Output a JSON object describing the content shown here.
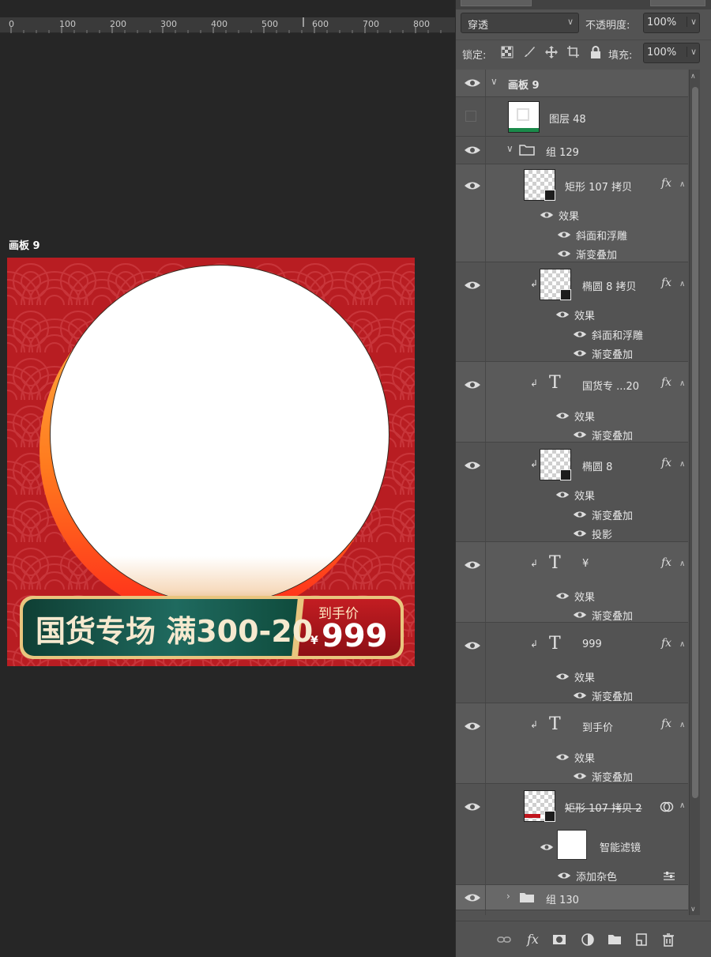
{
  "ruler": {
    "ticks": [
      "0",
      "100",
      "200",
      "300",
      "400",
      "500",
      "600",
      "700",
      "800"
    ]
  },
  "artboard": {
    "label": "画板 9",
    "promo_text": "国货专场 满300-20",
    "price_label": "到手价",
    "price_currency": "¥",
    "price_value": "999"
  },
  "panel": {
    "blend_mode": "穿透",
    "opacity_label": "不透明度:",
    "opacity_value": "100%",
    "lock_label": "锁定:",
    "fill_label": "填充:",
    "fill_value": "100%"
  },
  "layers": {
    "artboard_group": "画板 9",
    "layer48": "图层 48",
    "group129": "组 129",
    "rect107": {
      "name": "矩形 107 拷贝",
      "effects": "效果",
      "fx1": "斜面和浮雕",
      "fx2": "渐变叠加"
    },
    "ellipse8copy": {
      "name": "椭圆 8 拷贝",
      "effects": "效果",
      "fx1": "斜面和浮雕",
      "fx2": "渐变叠加"
    },
    "text_promo": {
      "name": "国货专 ...20",
      "effects": "效果",
      "fx1": "渐变叠加"
    },
    "ellipse8": {
      "name": "椭圆 8",
      "effects": "效果",
      "fx1": "渐变叠加",
      "fx2": "投影"
    },
    "text_yen": {
      "name": "¥",
      "effects": "效果",
      "fx1": "渐变叠加"
    },
    "text_999": {
      "name": "999",
      "effects": "效果",
      "fx1": "渐变叠加"
    },
    "text_price": {
      "name": "到手价",
      "effects": "效果",
      "fx1": "渐变叠加"
    },
    "rect107copy2": {
      "name": "矩形 107 拷贝 2",
      "smart_filter": "智能滤镜",
      "filter1": "添加杂色"
    },
    "group130": "组 130",
    "fx_symbol": "fx"
  },
  "colors": {
    "artboard_bg": "#b81d22",
    "promo_green": "#1f6a5f",
    "gold_outline": "#e9c57e",
    "panel_bg": "#535353"
  }
}
